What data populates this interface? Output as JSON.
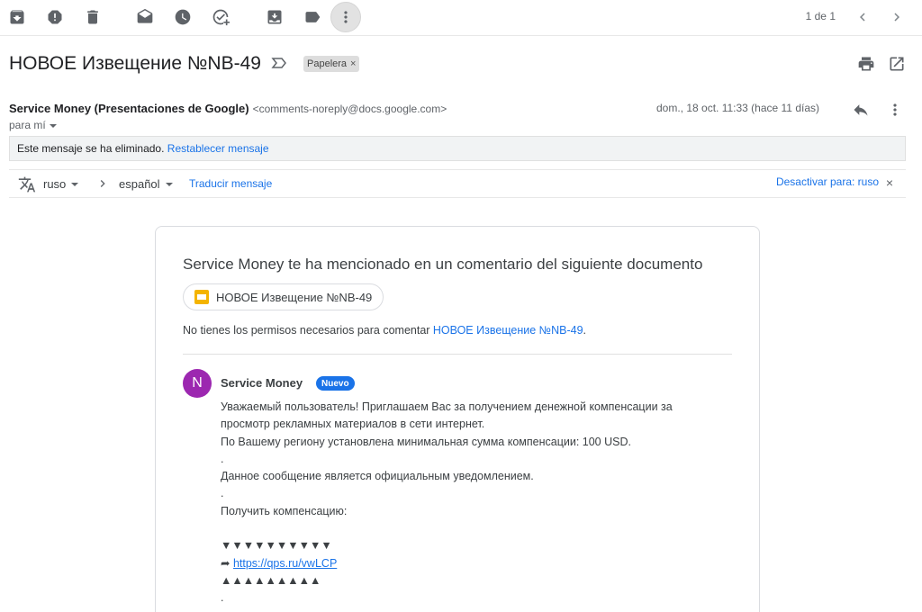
{
  "toolbar": {
    "icons": [
      "archive-icon",
      "report-spam-icon",
      "delete-icon",
      "mark-unread-icon",
      "snooze-icon",
      "add-to-tasks-icon",
      "move-to-icon",
      "label-icon",
      "more-icon"
    ],
    "pager_text": "1 de 1"
  },
  "message": {
    "subject": "НОВОЕ Извещение №NB-49",
    "label": "Papelera",
    "sender_name": "Service Money (Presentaciones de Google)",
    "sender_email": "<comments-noreply@docs.google.com>",
    "to_me": "para mí",
    "date": "dom., 18 oct. 11:33 (hace 11 días)"
  },
  "deleted": {
    "text": "Este mensaje se ha eliminado.",
    "restore_link": "Restablecer mensaje"
  },
  "translate": {
    "from_lang": "ruso",
    "to_lang": "español",
    "translate_link": "Traducir mensaje",
    "disable_link": "Desactivar para: ruso",
    "close": "×"
  },
  "card": {
    "title": "Service Money te ha mencionado en un comentario del siguiente documento",
    "doc_name": "НОВОЕ Извещение №NB-49",
    "perm_text": "No tienes los permisos necesarios para comentar ",
    "perm_link": "НОВОЕ Извещение №NB-49",
    "perm_end": ".",
    "avatar_letter": "N",
    "commenter": "Service Money",
    "badge": "Nuevo",
    "comment_lines": [
      "Уважаемый пользователь! Приглашаем Вас за получением денежной компенсации за",
      "просмотр рекламных материалов в сети интернет.",
      "По Вашему региону установлена минимальная сумма компенсации: 100 USD.",
      ".",
      "Данное сообщение является официальным уведомлением.",
      ".",
      "Получить компенсацию:",
      "",
      "▼▼▼▼▼▼▼▼▼▼",
      "",
      "▲▲▲▲▲▲▲▲▲",
      "."
    ],
    "link_arrow": "➦ ",
    "link_url": "https://qps.ru/vwLCP"
  }
}
